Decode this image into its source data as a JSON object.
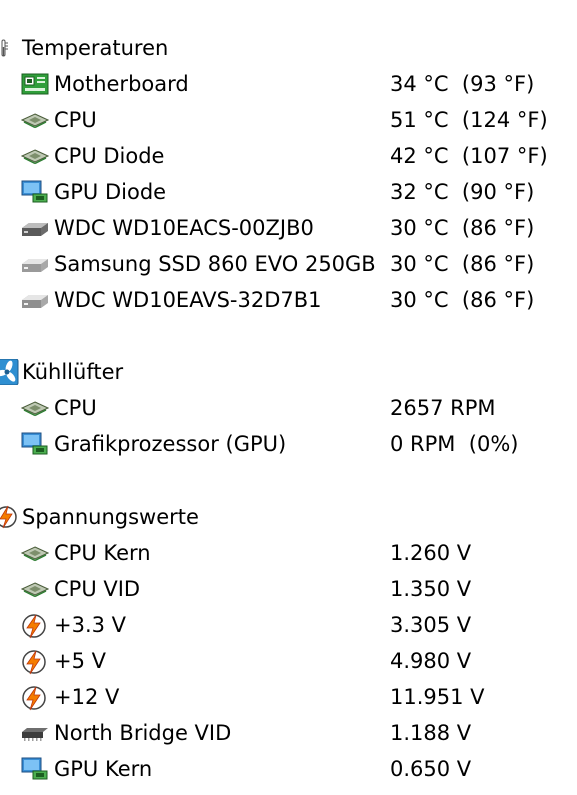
{
  "sections": [
    {
      "title": "Temperaturen",
      "icon": "thermometer-icon",
      "rows": [
        {
          "label": "Motherboard",
          "value": "34 °C  (93 °F)",
          "icon": "motherboard-icon"
        },
        {
          "label": "CPU",
          "value": "51 °C  (124 °F)",
          "icon": "cpu-chip-icon"
        },
        {
          "label": "CPU Diode",
          "value": "42 °C  (107 °F)",
          "icon": "cpu-chip-icon"
        },
        {
          "label": "GPU Diode",
          "value": "32 °C  (90 °F)",
          "icon": "gpu-monitor-icon"
        },
        {
          "label": "WDC WD10EACS-00ZJB0",
          "value": "30 °C  (86 °F)",
          "icon": "hard-drive-icon"
        },
        {
          "label": "Samsung SSD 860 EVO 250GB",
          "value": "30 °C  (86 °F)",
          "icon": "ssd-drive-icon"
        },
        {
          "label": "WDC WD10EAVS-32D7B1",
          "value": "30 °C  (86 °F)",
          "icon": "hard-drive-icon"
        }
      ]
    },
    {
      "title": "Kühllüfter",
      "icon": "fan-icon",
      "rows": [
        {
          "label": "CPU",
          "value": "2657 RPM",
          "icon": "cpu-chip-icon"
        },
        {
          "label": "Grafikprozessor (GPU)",
          "value": "0 RPM  (0%)",
          "icon": "gpu-monitor-icon"
        }
      ]
    },
    {
      "title": "Spannungswerte",
      "icon": "lightning-icon",
      "rows": [
        {
          "label": "CPU Kern",
          "value": "1.260 V",
          "icon": "cpu-chip-icon"
        },
        {
          "label": "CPU VID",
          "value": "1.350 V",
          "icon": "cpu-chip-icon"
        },
        {
          "label": "+3.3 V",
          "value": "3.305 V",
          "icon": "lightning-icon"
        },
        {
          "label": "+5 V",
          "value": "4.980 V",
          "icon": "lightning-icon"
        },
        {
          "label": "+12 V",
          "value": "11.951 V",
          "icon": "lightning-icon"
        },
        {
          "label": "North Bridge VID",
          "value": "1.188 V",
          "icon": "chipset-icon"
        },
        {
          "label": "GPU Kern",
          "value": "0.650 V",
          "icon": "gpu-monitor-icon"
        }
      ]
    }
  ]
}
